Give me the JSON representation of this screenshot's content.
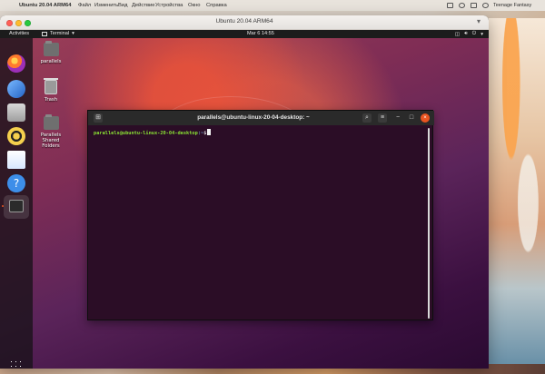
{
  "mac_menubar": {
    "app_name": "Ubuntu 20.04 ARM64",
    "menus": [
      "Файл",
      "Изменить",
      "Вид",
      "Действие",
      "Устройства",
      "Окно",
      "Справка"
    ],
    "profile": "Teenage Fantasy"
  },
  "vm_window": {
    "title": "Ubuntu 20.04 ARM64"
  },
  "ubuntu_topbar": {
    "activities": "Activities",
    "app_menu": "Terminal",
    "clock": "Mar 6  14:55"
  },
  "dock": {
    "items": [
      {
        "name": "firefox",
        "icon": "firefox-icon"
      },
      {
        "name": "thunderbird",
        "icon": "mail-icon"
      },
      {
        "name": "files",
        "icon": "files-icon"
      },
      {
        "name": "rhythmbox",
        "icon": "music-icon"
      },
      {
        "name": "libreoffice-writer",
        "icon": "document-icon"
      },
      {
        "name": "help",
        "icon": "help-icon"
      },
      {
        "name": "terminal",
        "icon": "terminal-icon"
      }
    ],
    "show_apps": "apps-grid-icon"
  },
  "desktop": {
    "icons": [
      {
        "label": "parallels",
        "icon": "folder-icon"
      },
      {
        "label": "Trash",
        "icon": "trash-icon"
      },
      {
        "label": "Parallels Shared Folders",
        "icon": "folder-icon"
      }
    ]
  },
  "terminal": {
    "title": "parallels@ubuntu-linux-20-04-desktop: ~",
    "prompt_user_host": "parallels@ubuntu-linux-20-04-desktop",
    "prompt_path": ":~",
    "prompt_symbol": "$"
  },
  "colors": {
    "ubuntu_orange": "#e95420",
    "terminal_bg": "#2b0d26",
    "terminal_header": "#2a2a2a"
  }
}
